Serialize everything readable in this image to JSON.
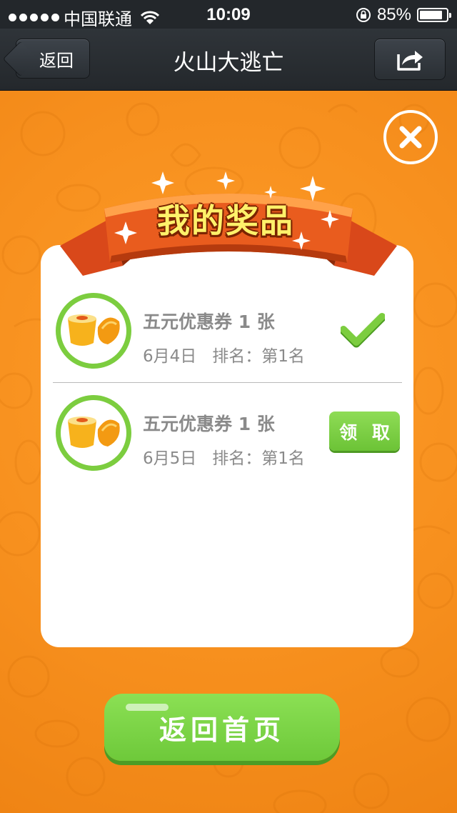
{
  "status_bar": {
    "carrier": "中国联通",
    "time": "10:09",
    "battery_percent": "85%",
    "battery_level": 0.85
  },
  "nav": {
    "back_label": "返回",
    "title": "火山大逃亡",
    "share_icon": "share-icon"
  },
  "popup": {
    "title": "我的奖品",
    "close_icon": "close-icon",
    "prizes": [
      {
        "name": "五元优惠券 1 张",
        "date": "6月4日",
        "rank": "排名：第1名",
        "status": "claimed",
        "status_icon": "checkmark-icon"
      },
      {
        "name": "五元优惠券 1 张",
        "date": "6月5日",
        "rank": "排名：第1名",
        "status": "unclaimed",
        "action_label": "领 取"
      }
    ]
  },
  "home_button_label": "返回首页",
  "colors": {
    "background": "#f7901e",
    "navbar": "#2a2f34",
    "accent_green": "#7ccd3f",
    "text_gray": "#8a8a8a",
    "ribbon": "#e4521b",
    "title_yellow": "#fff16a"
  }
}
